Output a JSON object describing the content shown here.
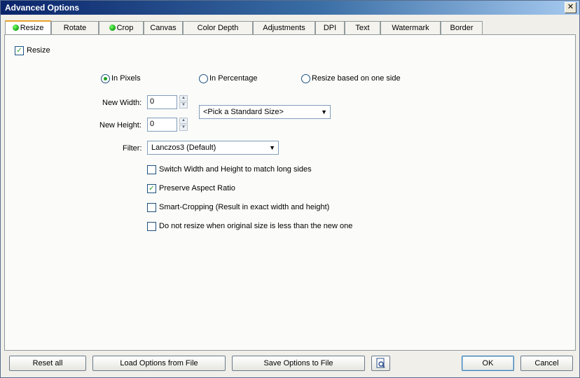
{
  "window": {
    "title": "Advanced Options"
  },
  "tabs": [
    {
      "label": "Resize",
      "dot": true
    },
    {
      "label": "Rotate",
      "dot": false
    },
    {
      "label": "Crop",
      "dot": true
    },
    {
      "label": "Canvas",
      "dot": false
    },
    {
      "label": "Color Depth",
      "dot": false
    },
    {
      "label": "Adjustments",
      "dot": false
    },
    {
      "label": "DPI",
      "dot": false
    },
    {
      "label": "Text",
      "dot": false
    },
    {
      "label": "Watermark",
      "dot": false
    },
    {
      "label": "Border",
      "dot": false
    }
  ],
  "resize": {
    "enable_label": "Resize",
    "enable_checked": true,
    "mode_options": {
      "pixels": "In Pixels",
      "percentage": "In Percentage",
      "one_side": "Resize based on one side"
    },
    "selected_mode": "pixels",
    "width_label": "New Width:",
    "width_value": "0",
    "height_label": "New Height:",
    "height_value": "0",
    "standard_size": "<Pick a Standard Size>",
    "filter_label": "Filter:",
    "filter_value": "Lanczos3 (Default)",
    "options": [
      {
        "label": "Switch Width and Height to match long sides",
        "checked": false
      },
      {
        "label": "Preserve Aspect Ratio",
        "checked": true
      },
      {
        "label": "Smart-Cropping (Result in exact width and height)",
        "checked": false
      },
      {
        "label": "Do not resize when original size is less than the new one",
        "checked": false
      }
    ]
  },
  "footer": {
    "reset": "Reset all",
    "load": "Load Options from File",
    "save": "Save Options to File",
    "ok": "OK",
    "cancel": "Cancel"
  },
  "icons": {
    "close": "close-icon",
    "preview": "preview-search-icon",
    "status_dot_color": "#10a410"
  }
}
